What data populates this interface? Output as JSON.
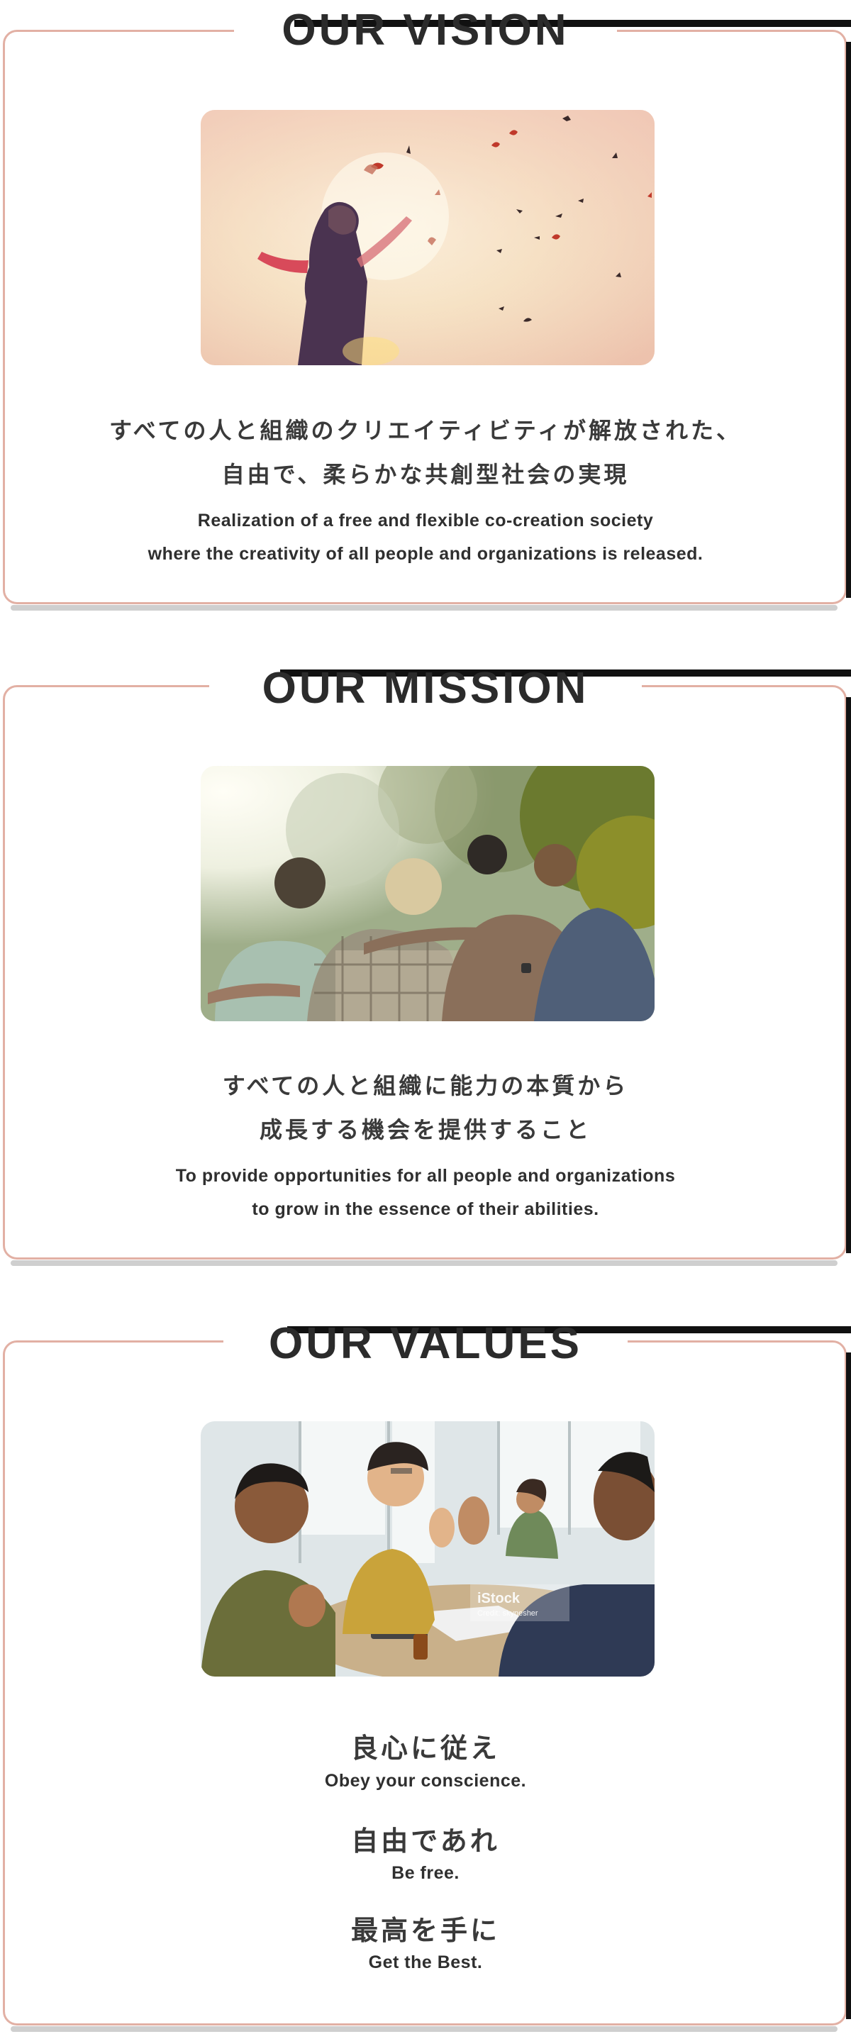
{
  "vision": {
    "heading": "OUR VISION",
    "image_alt": "Person with open arms in sunset light with birds flying",
    "jp_lines": [
      "すべての人と組織のクリエイティビティが解放された、",
      "自由で、柔らかな共創型社会の実現"
    ],
    "en_lines": [
      "Realization of a free and flexible co-creation society",
      "where the creativity of all people and organizations is released."
    ]
  },
  "mission": {
    "heading": "OUR MISSION",
    "image_alt": "Group of friends embracing outdoors under trees",
    "jp_lines": [
      "すべての人と組織に能力の本質から",
      "成長する機会を提供すること"
    ],
    "en_lines": [
      "To provide opportunities for all people and organizations",
      "to grow in the essence of their abilities."
    ]
  },
  "values": {
    "heading": "OUR VALUES",
    "image_alt": "Team members giving high-fives at a meeting table",
    "watermark": "iStock",
    "watermark_credit": "Credit: skynesher",
    "items": [
      {
        "jp": "良心に従え",
        "en": "Obey your conscience."
      },
      {
        "jp": "自由であれ",
        "en": "Be free."
      },
      {
        "jp": "最高を手に",
        "en": "Get the Best."
      }
    ]
  },
  "colors": {
    "card_border": "#e2b0a4",
    "text": "#3a3a3a",
    "shadow_bar": "#111111"
  }
}
